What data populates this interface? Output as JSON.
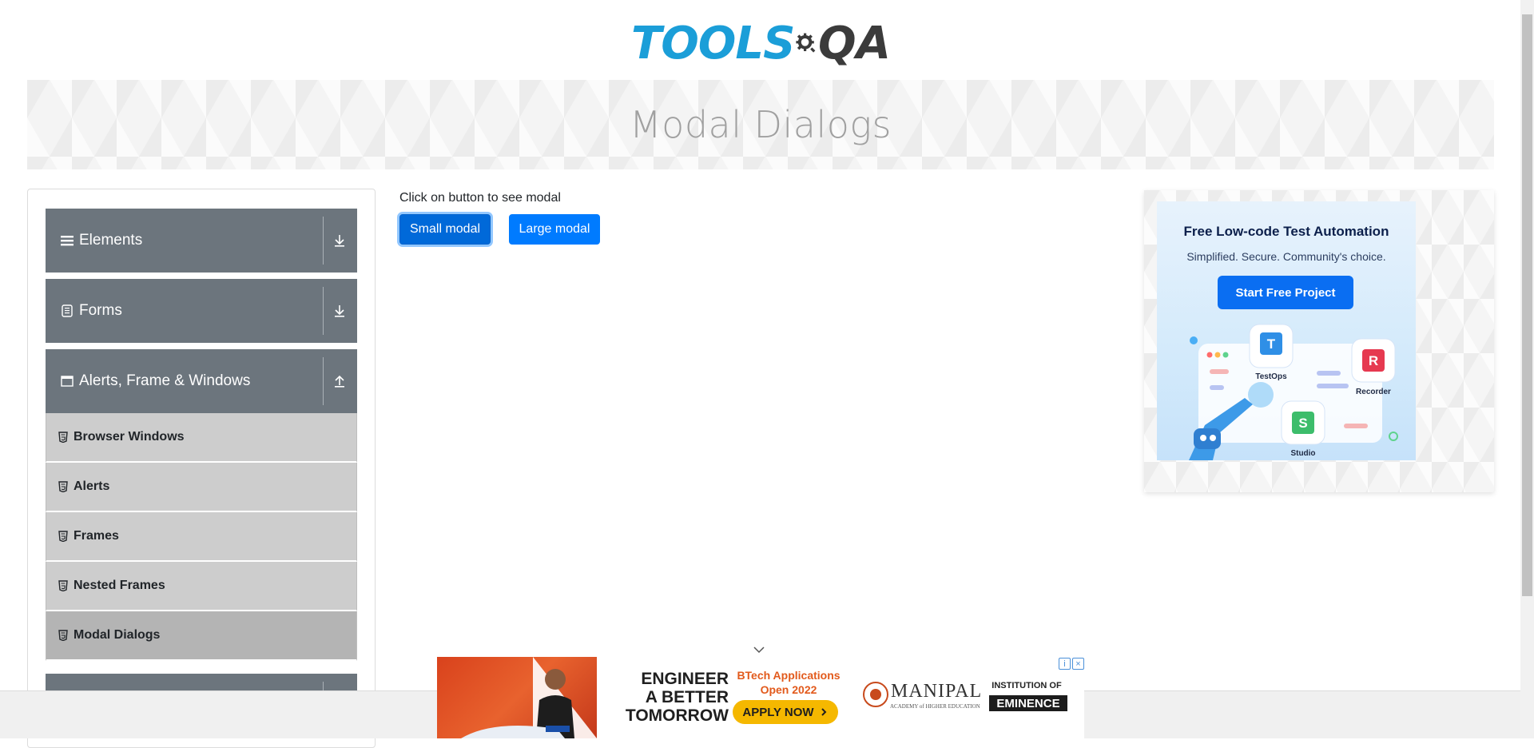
{
  "header": {
    "logo_text": "TOOLS",
    "logo_accent": "QA",
    "logo_colors": {
      "primary": "#1b9ed8",
      "accent": "#3b3b3b"
    }
  },
  "banner": {
    "title": "Modal Dialogs"
  },
  "sidebar": {
    "groups": [
      {
        "label": "Elements",
        "icon": "hamburger-icon",
        "arrow": "download-arrow-icon",
        "expanded": false
      },
      {
        "label": "Forms",
        "icon": "form-icon",
        "arrow": "download-arrow-icon",
        "expanded": false
      },
      {
        "label": "Alerts, Frame & Windows",
        "icon": "window-icon",
        "arrow": "upload-arrow-icon",
        "expanded": true
      }
    ],
    "items": [
      {
        "label": "Browser Windows",
        "icon": "html5-icon",
        "active": false
      },
      {
        "label": "Alerts",
        "icon": "html5-icon",
        "active": false
      },
      {
        "label": "Frames",
        "icon": "html5-icon",
        "active": false
      },
      {
        "label": "Nested Frames",
        "icon": "html5-icon",
        "active": false
      },
      {
        "label": "Modal Dialogs",
        "icon": "html5-icon",
        "active": true
      }
    ]
  },
  "main": {
    "instruction": "Click on button to see modal",
    "small_modal_label": "Small modal",
    "large_modal_label": "Large modal"
  },
  "ad_right": {
    "title": "Free Low-code Test Automation",
    "subtitle": "Simplified. Secure. Community's choice.",
    "cta": "Start Free Project",
    "app_labels": [
      "TestOps",
      "Recorder",
      "Studio"
    ],
    "app_letters": [
      "T",
      "R",
      "S"
    ]
  },
  "ad_bottom": {
    "headline": [
      "ENGINEER",
      "A BETTER",
      "TOMORROW"
    ],
    "btech_line1": "BTech Applications",
    "btech_line2": "Open 2022",
    "apply": "APPLY NOW",
    "brand": "MANIPAL",
    "brand_sub": "ACADEMY of HIGHER EDUCATION",
    "institution": "INSTITUTION OF",
    "eminence": "EMINENCE",
    "controls": [
      "i",
      "×"
    ]
  }
}
